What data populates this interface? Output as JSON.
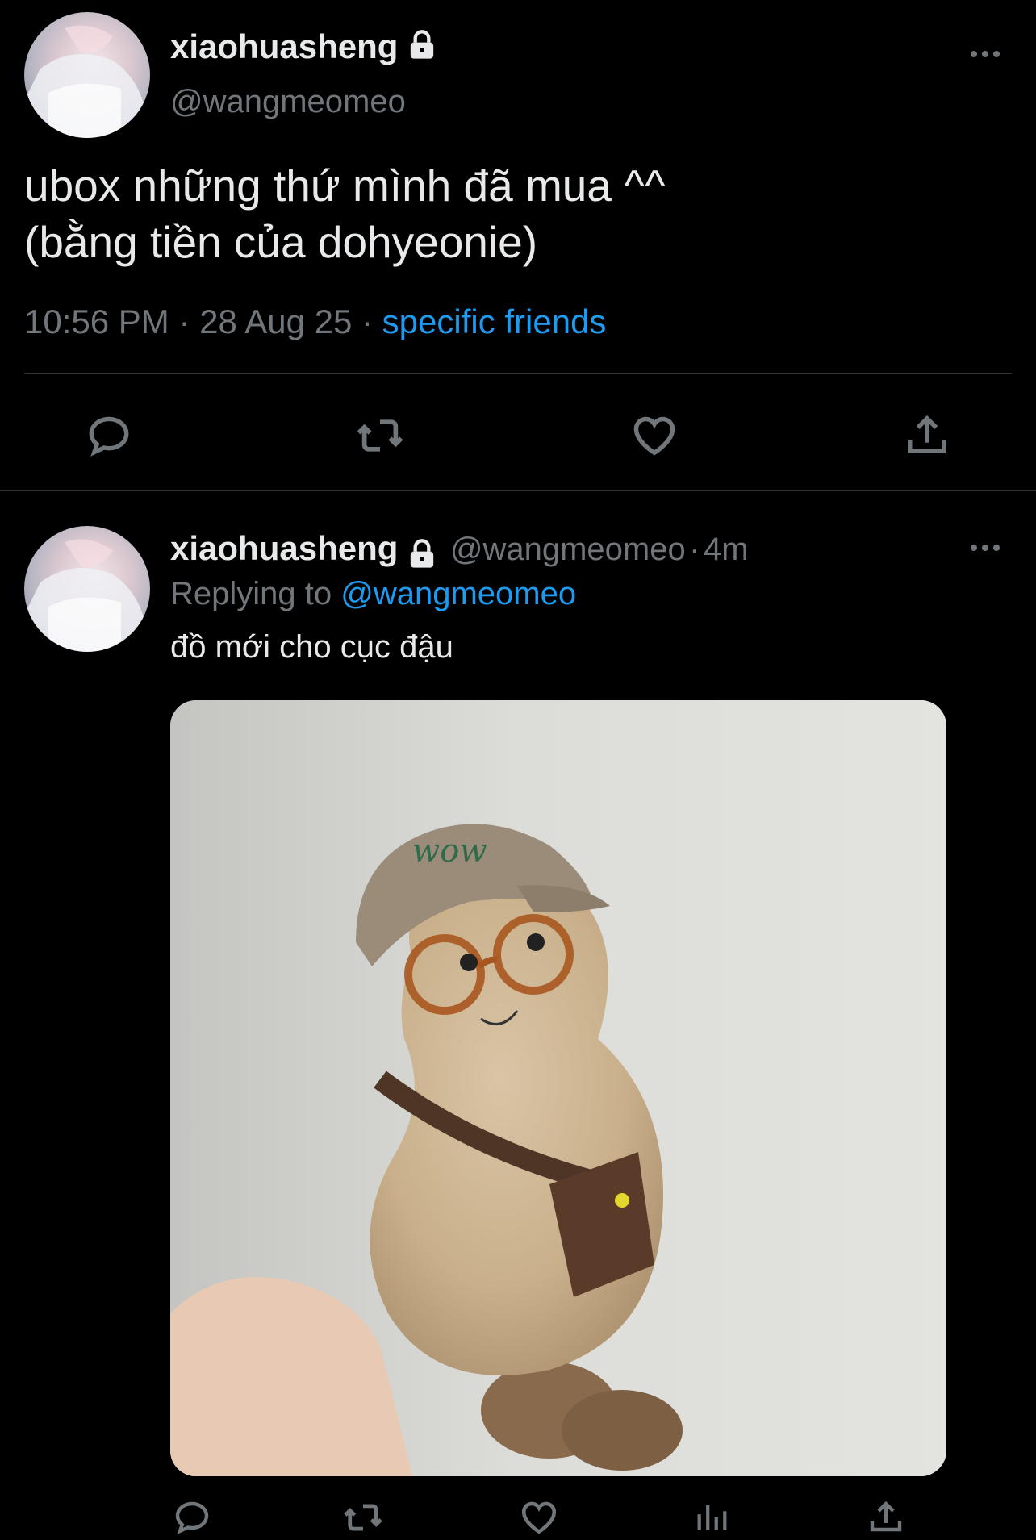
{
  "main_tweet": {
    "display_name": "xiaohuasheng",
    "handle": "@wangmeomeo",
    "text_line1": "ubox những thứ mình đã mua ^^",
    "text_line2": "(bằng tiền của dohyeonie)",
    "time": "10:56 PM",
    "date": "28 Aug 25",
    "audience": "specific friends",
    "separator": "·"
  },
  "reply_tweet": {
    "display_name": "xiaohuasheng",
    "handle": "@wangmeomeo",
    "age": "4m",
    "separator": "·",
    "replying_prefix": "Replying to",
    "replying_to": "@wangmeomeo",
    "text": "đồ mới cho cục đậu"
  },
  "icons": {
    "lock": "lock-icon",
    "more": "more-icon",
    "reply": "reply-icon",
    "retweet": "retweet-icon",
    "like": "heart-icon",
    "share": "share-icon",
    "views": "views-icon"
  },
  "colors": {
    "background": "#000000",
    "text_primary": "#e7e9ea",
    "text_secondary": "#71767b",
    "link": "#1d9bf0",
    "divider": "#2f3336"
  }
}
